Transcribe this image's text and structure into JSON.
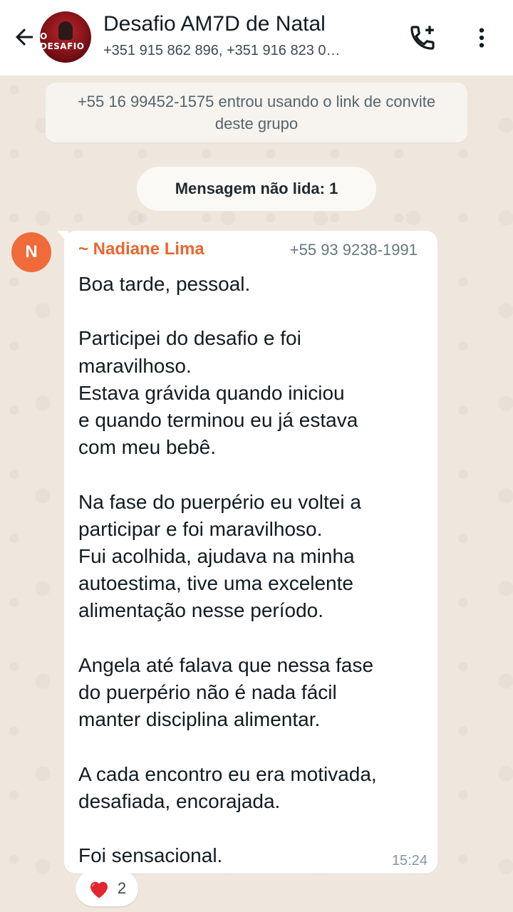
{
  "header": {
    "group_name": "Desafio AM7D de Natal",
    "participants": "+351 915 862 896, +351 916 823 0…",
    "avatar_text": "O DESAFIO",
    "back_icon": "arrow-left-icon",
    "call_icon": "add-call-icon",
    "menu_icon": "more-vertical-icon"
  },
  "system_message": "+55 16 99452-1575 entrou usando o link de convite deste grupo",
  "unread_banner": "Mensagem não lida: 1",
  "message": {
    "avatar_initial": "N",
    "sender_name": "~ Nadiane Lima",
    "sender_phone": "+55 93 9238-1991",
    "text": "Boa tarde, pessoal.\n\nParticipei do desafio e foi\nmaravilhoso.\nEstava grávida quando iniciou\ne quando terminou eu já estava\ncom meu bebê.\n\nNa fase do puerpério eu voltei a\nparticipar e foi maravilhoso.\nFui acolhida, ajudava na minha\nautoestima, tive uma excelente\nalimentação nesse período.\n\nAngela até falava que nessa fase\ndo puerpério não é nada fácil\nmanter disciplina alimentar.\n\nA cada encontro eu era motivada,\ndesafiada, encorajada.\n\nFoi sensacional.",
    "time": "15:24"
  },
  "reaction": {
    "emoji": "heart-icon",
    "count": "2"
  },
  "colors": {
    "sender_name": "#e8672e",
    "avatar_bg": "#ef6b3a",
    "wallpaper": "#efe7dd",
    "heart": "#e0262e"
  }
}
